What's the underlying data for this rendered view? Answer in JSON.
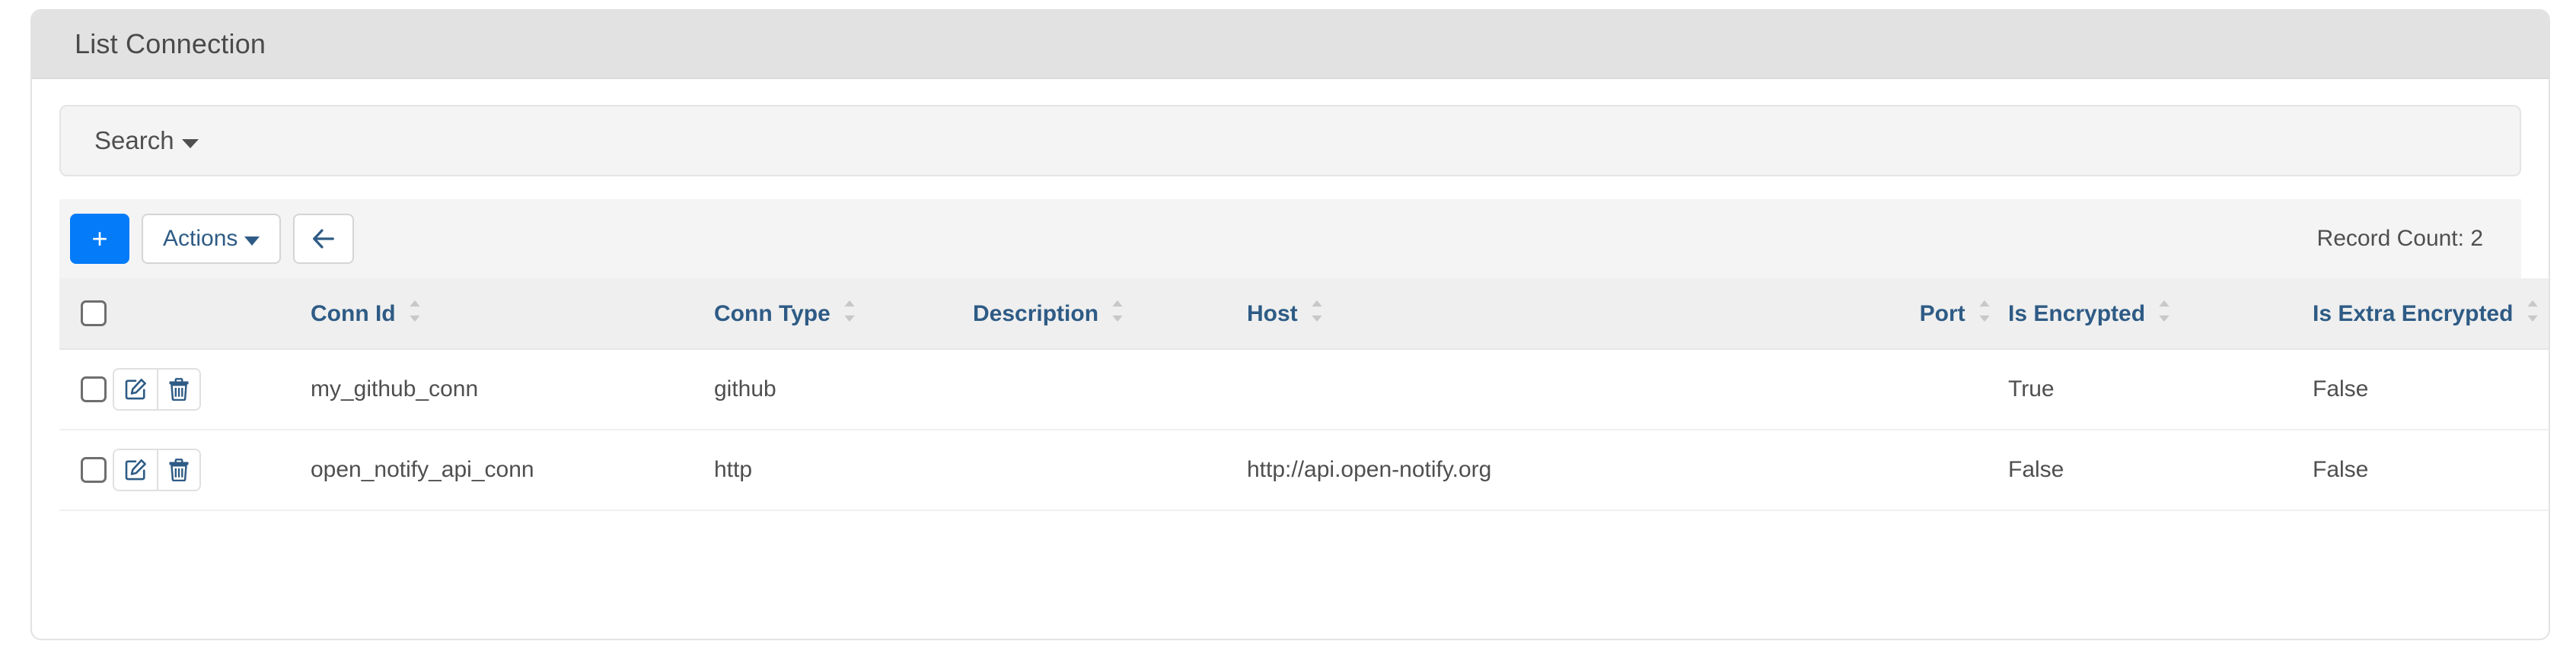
{
  "header": {
    "title": "List Connection"
  },
  "search": {
    "label": "Search",
    "caret_icon": "caret-down-icon"
  },
  "toolbar": {
    "add_label": "+",
    "actions_label": "Actions",
    "back_icon": "arrow-left-icon",
    "record_count_label": "Record Count: 2"
  },
  "table": {
    "select_all_name": "select-all-checkbox",
    "sort_icon": "sort-updown-icon",
    "columns": [
      {
        "key": "check",
        "label": ""
      },
      {
        "key": "act",
        "label": ""
      },
      {
        "key": "connid",
        "label": "Conn Id"
      },
      {
        "key": "type",
        "label": "Conn Type"
      },
      {
        "key": "desc",
        "label": "Description"
      },
      {
        "key": "host",
        "label": "Host"
      },
      {
        "key": "port",
        "label": "Port"
      },
      {
        "key": "enc",
        "label": "Is Encrypted"
      },
      {
        "key": "xenc",
        "label": "Is Extra Encrypted"
      }
    ],
    "rows": [
      {
        "conn_id": "my_github_conn",
        "conn_type": "github",
        "description": "",
        "host": "",
        "port": "",
        "is_encrypted": "True",
        "is_extra_encrypted": "False",
        "edit_icon": "edit-pencil-icon",
        "delete_icon": "trash-icon"
      },
      {
        "conn_id": "open_notify_api_conn",
        "conn_type": "http",
        "description": "",
        "host": "http://api.open-notify.org",
        "port": "",
        "is_encrypted": "False",
        "is_extra_encrypted": "False",
        "edit_icon": "edit-pencil-icon",
        "delete_icon": "trash-icon"
      }
    ]
  },
  "colors": {
    "primary": "#047bf8",
    "header_link": "#2e5b85",
    "panel_bg": "#f4f4f4",
    "card_header_bg": "#e2e2e2",
    "text": "#4f4f4f"
  }
}
